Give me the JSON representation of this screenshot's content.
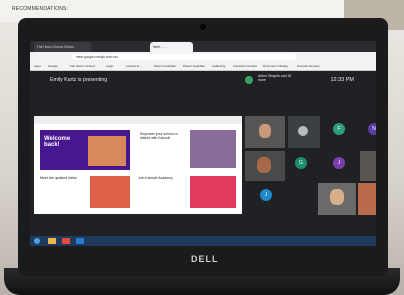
{
  "paper": {
    "heading": "RECOMMENDATIONS:"
  },
  "browser": {
    "tabs": [
      "Fair Haven School District",
      "Meet - ..."
    ],
    "url": "meet.google.com/gh-rkzn-xxx",
    "bookmarks": [
      "Apps",
      "Google",
      "Fair Haven School...",
      "Login",
      "Learner E...",
      "Parent Guardian",
      "Parent Guardian",
      "Cablezing",
      "Important Contact",
      "Document Catalog",
      "Pumpkin Employ..."
    ]
  },
  "meet": {
    "presenting": "Emily Kurtz is presenting",
    "other_participants": "Arthur Shapiro and 18 more",
    "time": "12:33 PM"
  },
  "shared_site": {
    "welcome": "Welcome back!",
    "card1": "Empower your school or district with Kahoot!",
    "card2": "Meet the updated editor",
    "card3": "Join Kahoot! Academy"
  },
  "tiles": [
    {
      "letter": "F",
      "color": "#2e9c7a"
    },
    {
      "letter": "N",
      "color": "#5b3fa8"
    },
    {
      "letter": "G",
      "color": "#1e8f6c"
    },
    {
      "letter": "J",
      "color": "#7b3fa8"
    },
    {
      "letter": "J",
      "color": "#1e88c8"
    }
  ],
  "laptop_brand": "DELL"
}
